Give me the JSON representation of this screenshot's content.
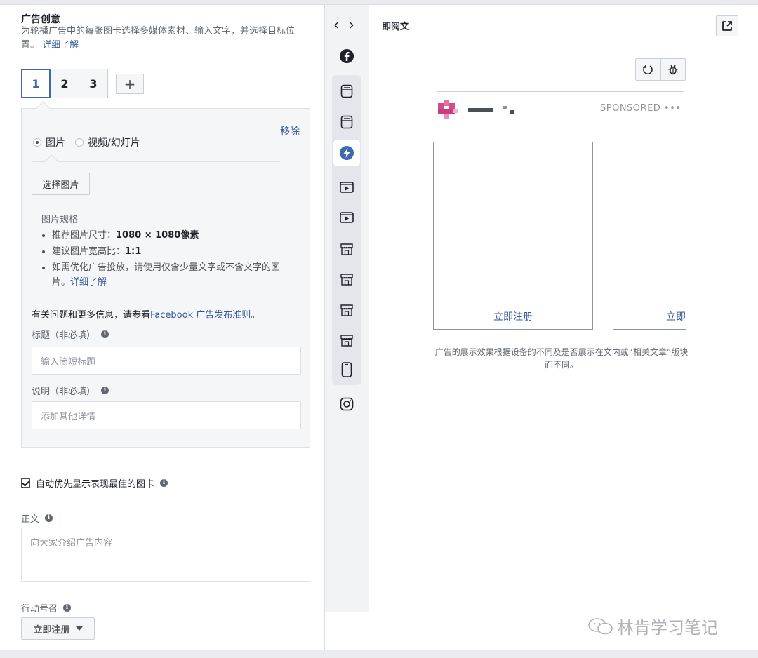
{
  "left": {
    "title": "广告创意",
    "desc": "为轮播广告中的每张图卡选择多媒体素材、输入文字，并选择目标位置。",
    "desc_link": "详细了解",
    "tabs": [
      "1",
      "2",
      "3"
    ],
    "add_tab": "+",
    "remove": "移除",
    "media_options": [
      "图片",
      "视频/幻灯片"
    ],
    "select_image": "选择图片",
    "spec_title": "图片规格",
    "spec1_label": "推荐图片尺寸：",
    "spec1_value": "1080 × 1080像素",
    "spec2_label": "建议图片宽高比：",
    "spec2_value": "1:1",
    "spec3_text": "如需优化广告投放，请使用仅含少量文字或不含文字的图片。",
    "spec3_link": "详细了解",
    "policy_prefix": "有关问题和更多信息，请参看",
    "policy_link": "Facebook 广告发布准则",
    "policy_suffix": "。",
    "headline_label": "标题（非必填）",
    "headline_placeholder": "输入简短标题",
    "desc_field_label": "说明（非必填）",
    "desc_field_placeholder": "添加其他详情",
    "auto_optimize": "自动优先显示表现最佳的图卡",
    "body_label": "正文",
    "body_placeholder": "向大家介绍广告内容",
    "cta_label": "行动号召",
    "cta_value": "立即注册"
  },
  "mid": {
    "icons": [
      "facebook-icon",
      "feed-icon",
      "feed-icon",
      "instant-article-icon",
      "video-icon",
      "video-icon",
      "marketplace-icon",
      "marketplace-icon",
      "marketplace-icon",
      "marketplace-icon",
      "mobile-icon",
      "instagram-icon"
    ]
  },
  "preview": {
    "title": "即阅文",
    "sponsored": "SPONSORED •••",
    "slide_cta": "立即注册",
    "slide_cta_partial": "立即",
    "note": "广告的展示效果根据设备的不同及是否展示在文内或“相关文章”版块而不同。",
    "watermark": "林肯学习笔记"
  },
  "colors": {
    "accent": "#4267b2",
    "link": "#365899",
    "panel_bg": "#f5f6f7",
    "border": "#dddfe2"
  }
}
